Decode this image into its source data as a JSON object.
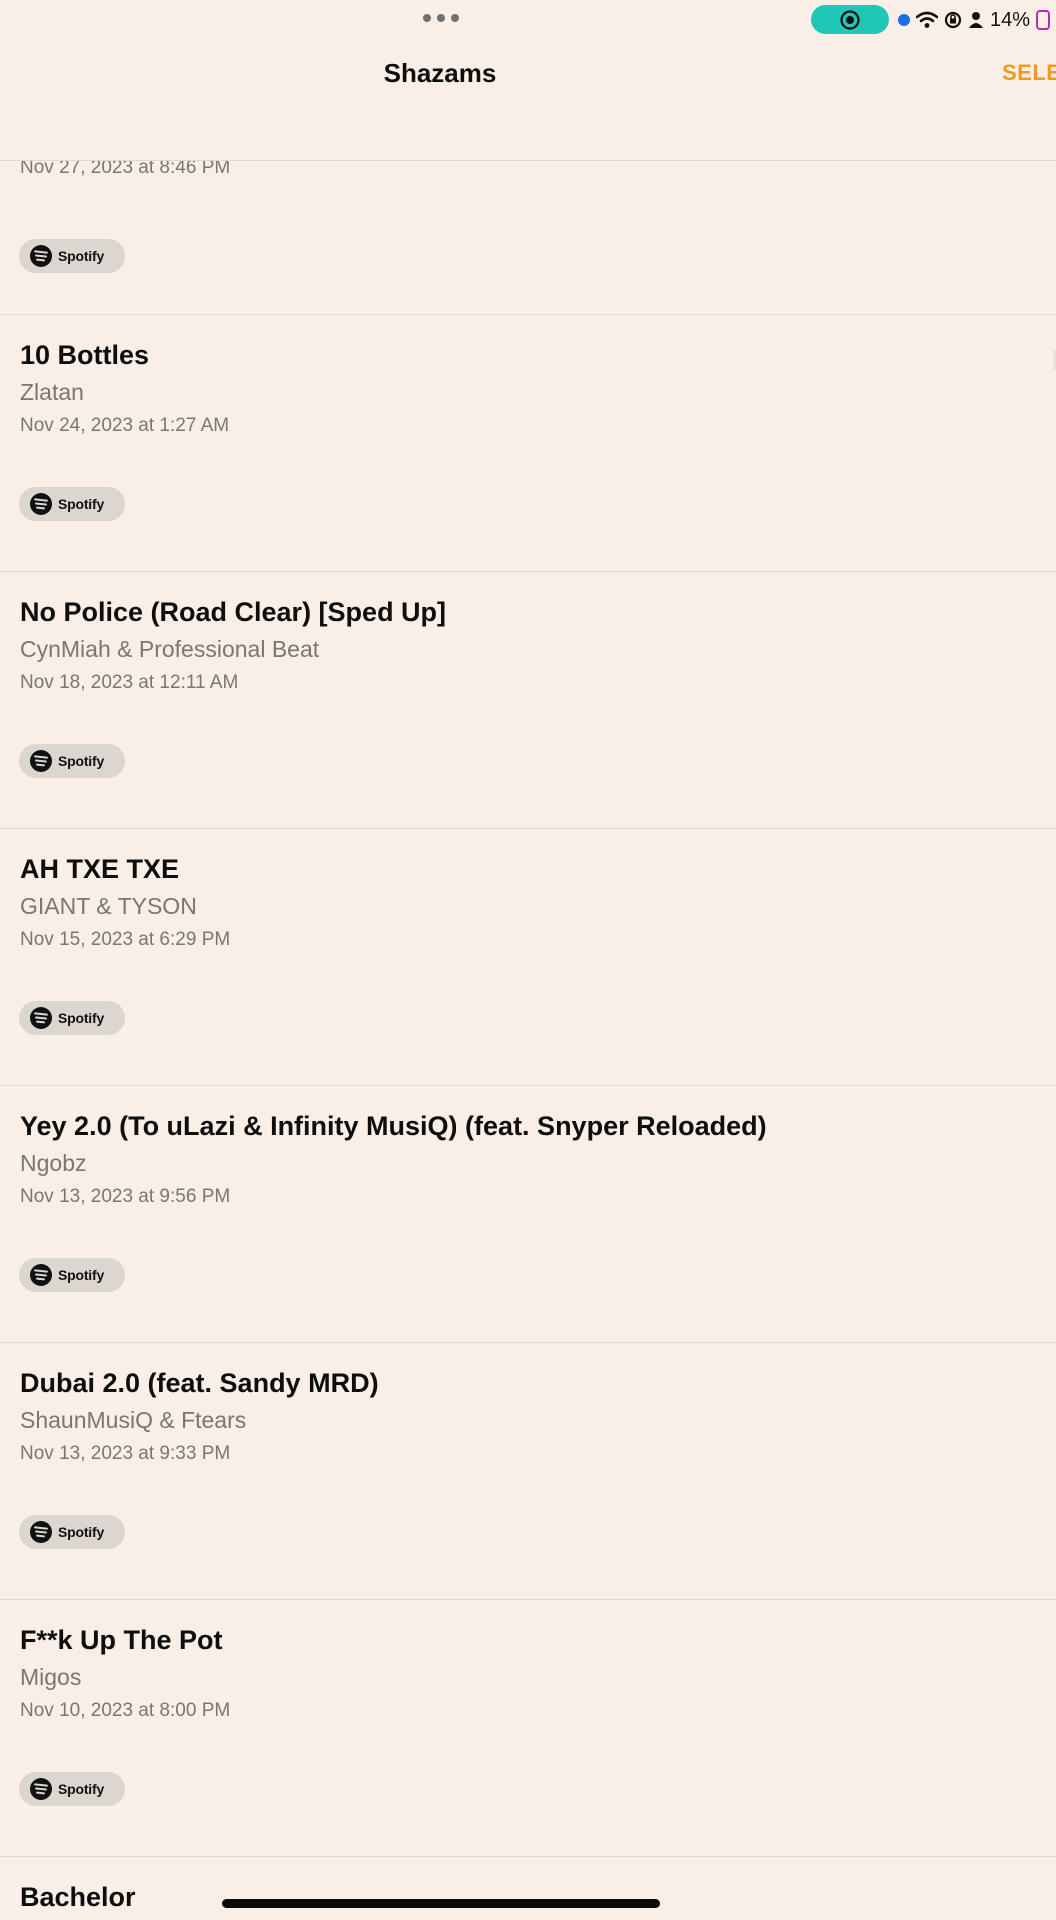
{
  "status_bar": {
    "battery_text": "14%"
  },
  "nav": {
    "title": "Shazams",
    "select_label": "SELE"
  },
  "partial_item": {
    "date": "Nov 27, 2023 at 8:46 PM",
    "service": "Spotify"
  },
  "items": [
    {
      "title": "10 Bottles",
      "artist": "Zlatan",
      "date": "Nov 24, 2023 at 1:27 AM",
      "service": "Spotify"
    },
    {
      "title": "No Police (Road Clear) [Sped Up]",
      "artist": "CynMiah & Professional Beat",
      "date": "Nov 18, 2023 at 12:11 AM",
      "service": "Spotify"
    },
    {
      "title": "AH TXE TXE",
      "artist": "GIANT & TYSON",
      "date": "Nov 15, 2023 at 6:29 PM",
      "service": "Spotify"
    },
    {
      "title": "Yey 2.0 (To uLazi & Infinity MusiQ) (feat. Snyper Reloaded)",
      "artist": "Ngobz",
      "date": "Nov 13, 2023 at 9:56 PM",
      "service": "Spotify"
    },
    {
      "title": "Dubai 2.0 (feat. Sandy MRD)",
      "artist": "ShaunMusiQ & Ftears",
      "date": "Nov 13, 2023 at 9:33 PM",
      "service": "Spotify"
    },
    {
      "title": "F**k Up The Pot",
      "artist": "Migos",
      "date": "Nov 10, 2023 at 8:00 PM",
      "service": "Spotify"
    },
    {
      "title": "Bachelor",
      "artist": "",
      "date": "",
      "service": ""
    }
  ]
}
